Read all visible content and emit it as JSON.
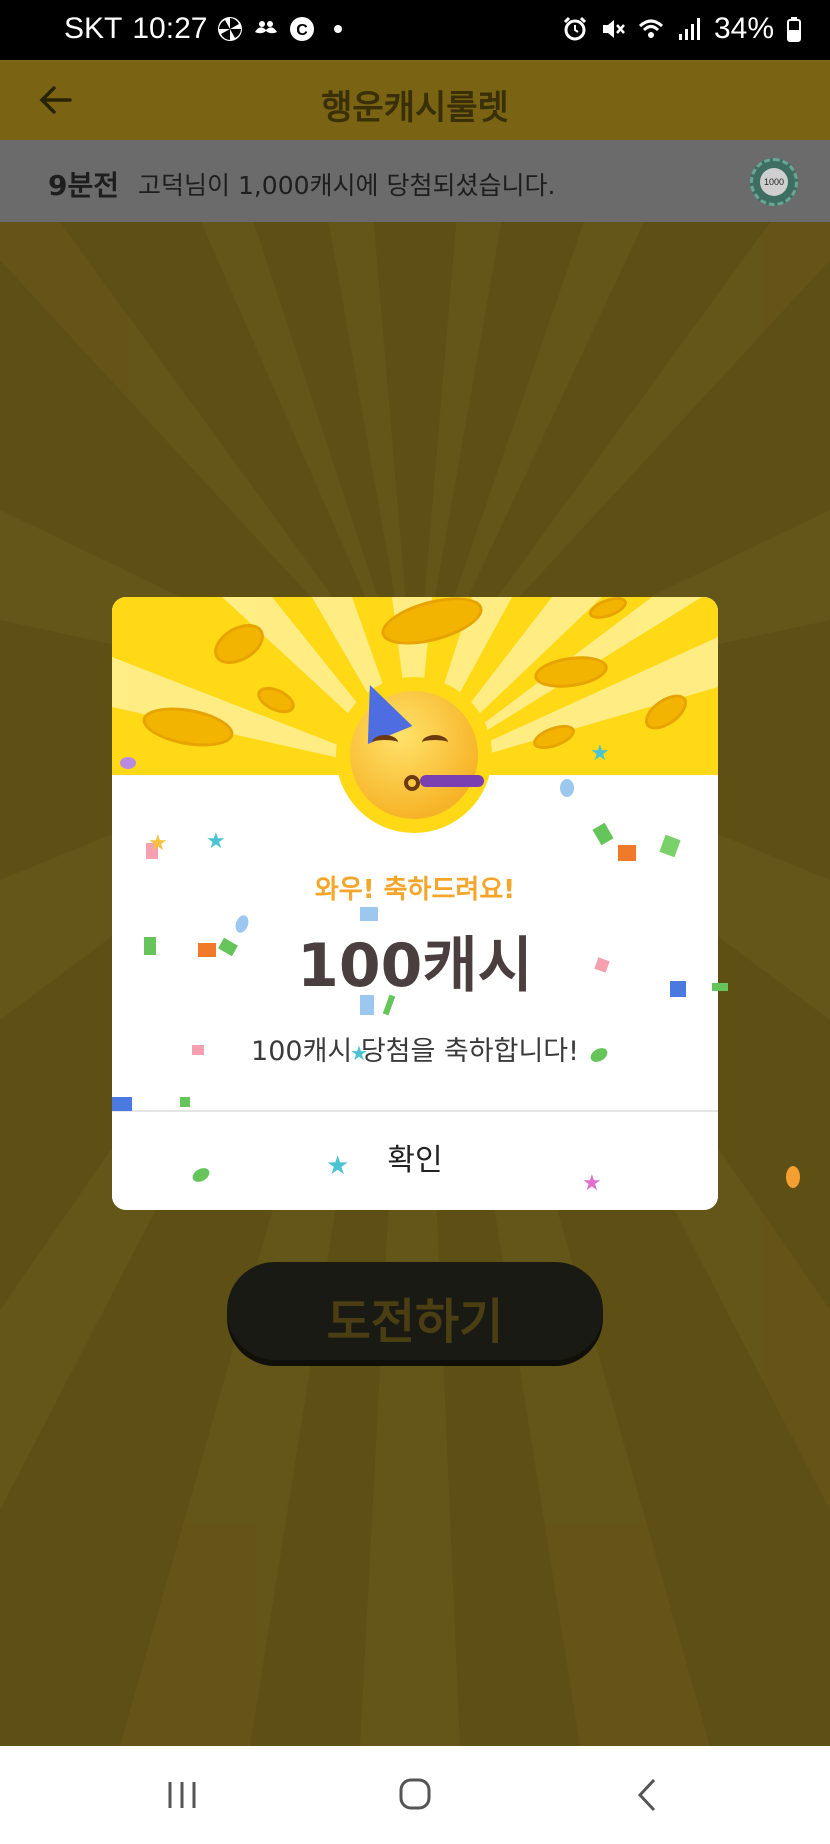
{
  "status_bar": {
    "carrier": "SKT",
    "time": "10:27",
    "battery": "34%",
    "icons": [
      "pinwheel-icon",
      "mustache-icon",
      "c-app-icon",
      "dot-icon",
      "alarm-icon",
      "mute-icon",
      "wifi-icon",
      "signal-icon",
      "battery-icon"
    ]
  },
  "header": {
    "title": "행운캐시룰렛"
  },
  "ticker": {
    "time_ago": "9분전",
    "message": "고덕님이 1,000캐시에 당첨되셨습니다.",
    "chip_label": "1000"
  },
  "main": {
    "cta_label": "도전하기"
  },
  "dialog": {
    "subtitle": "와우! 축하드려요!",
    "amount": "100캐시",
    "message": "100캐시 당첨을 축하합니다!",
    "confirm_label": "확인"
  },
  "colors": {
    "accent": "#ffd916",
    "subtitle": "#f4a52a",
    "amount_text": "#4a3e3e"
  }
}
